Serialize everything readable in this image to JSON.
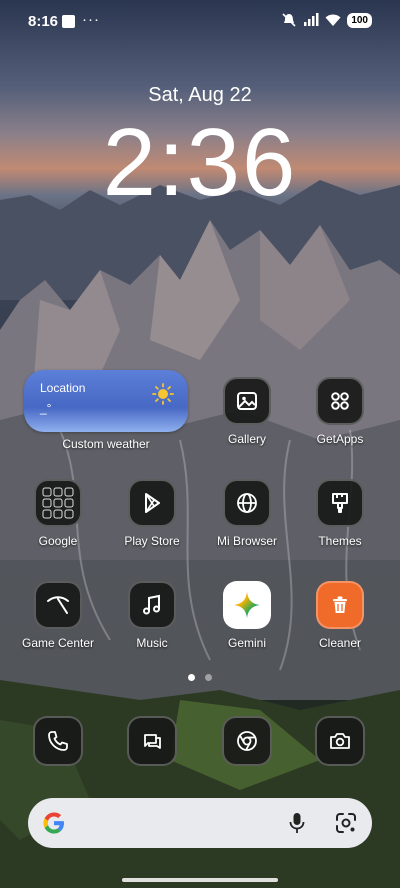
{
  "status_bar": {
    "time": "8:16",
    "overflow": "···",
    "battery": "100"
  },
  "lockscreen": {
    "date": "Sat, Aug 22",
    "time": "2:36"
  },
  "widget": {
    "location": "Location",
    "temperature": "_°",
    "label": "Custom weather",
    "icon": "sun-icon"
  },
  "apps": {
    "row1": [
      {
        "label": "Gallery",
        "icon": "gallery-icon"
      },
      {
        "label": "GetApps",
        "icon": "getapps-icon"
      }
    ],
    "row2": [
      {
        "label": "Google",
        "icon": "google-folder-icon"
      },
      {
        "label": "Play Store",
        "icon": "play-store-icon"
      },
      {
        "label": "Mi Browser",
        "icon": "globe-icon"
      },
      {
        "label": "Themes",
        "icon": "brush-icon"
      }
    ],
    "row3": [
      {
        "label": "Game Center",
        "icon": "game-center-icon"
      },
      {
        "label": "Music",
        "icon": "music-note-icon"
      },
      {
        "label": "Gemini",
        "icon": "gemini-icon"
      },
      {
        "label": "Cleaner",
        "icon": "trash-icon"
      }
    ]
  },
  "dock": [
    {
      "name": "Phone",
      "icon": "phone-icon"
    },
    {
      "name": "Messages",
      "icon": "messages-icon"
    },
    {
      "name": "Chrome",
      "icon": "chrome-icon"
    },
    {
      "name": "Camera",
      "icon": "camera-icon"
    }
  ],
  "page_indicator": {
    "pages": 2,
    "current": 1
  },
  "search_bar": {
    "logo": "google-g-icon",
    "mic": "microphone-icon",
    "lens": "lens-icon"
  },
  "colors": {
    "widget_top": "#5c7fd8",
    "cleaner_orange": "#f06a2a",
    "tile_bg": "#181918"
  }
}
